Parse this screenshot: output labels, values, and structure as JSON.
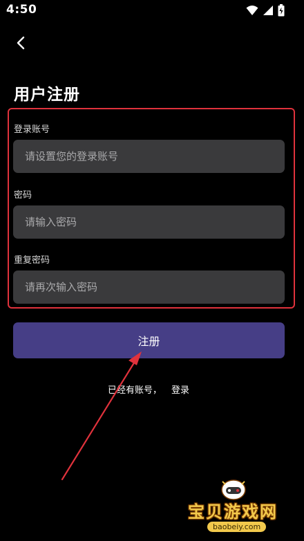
{
  "status_bar": {
    "time": "4:50"
  },
  "header": {
    "back_icon": "chevron-left-icon",
    "title": "用户注册"
  },
  "form": {
    "account": {
      "label": "登录账号",
      "placeholder": "请设置您的登录账号",
      "value": ""
    },
    "password": {
      "label": "密码",
      "placeholder": "请输入密码",
      "value": ""
    },
    "confirm_password": {
      "label": "重复密码",
      "placeholder": "请再次输入密码",
      "value": ""
    }
  },
  "actions": {
    "register_label": "注册",
    "login_prompt": "已经有账号，",
    "login_link": "登录"
  },
  "watermark": {
    "text": "宝贝游戏网",
    "url": "baobeiy.com"
  },
  "colors": {
    "background": "#000000",
    "input_background": "#3a3a3c",
    "button_background": "#463e86",
    "highlight_border": "#e0323c",
    "annotation_arrow": "#e0323c"
  }
}
